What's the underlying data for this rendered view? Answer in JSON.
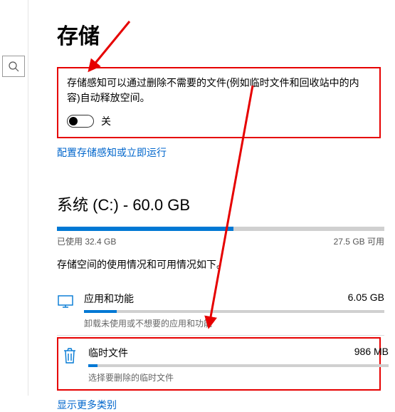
{
  "page_title": "存储",
  "storage_sense": {
    "description": "存储感知可以通过删除不需要的文件(例如临时文件和回收站中的内容)自动释放空间。",
    "toggle_state": "关",
    "configure_link": "配置存储感知或立即运行"
  },
  "drive": {
    "title": "系统 (C:) - 60.0 GB",
    "used_label": "已使用 32.4 GB",
    "free_label": "27.5 GB 可用",
    "used_fraction": 0.54,
    "usage_desc": "存储空间的使用情况和可用情况如下。"
  },
  "categories": {
    "apps": {
      "name": "应用和功能",
      "size": "6.05 GB",
      "sub": "卸载未使用或不想要的应用和功能",
      "fill": 0.11
    },
    "temp": {
      "name": "临时文件",
      "size": "986 MB",
      "sub": "选择要删除的临时文件",
      "fill": 0.03
    }
  },
  "show_more": "显示更多类别"
}
